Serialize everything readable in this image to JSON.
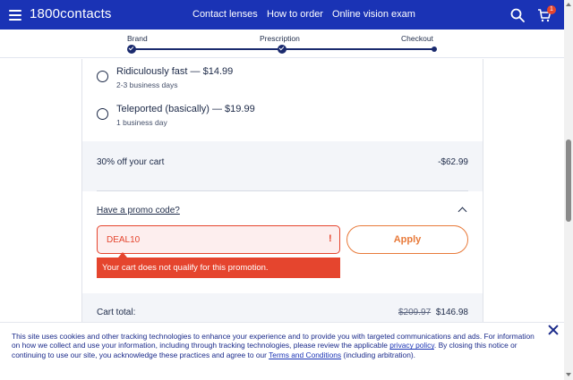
{
  "header": {
    "logo": "1800contacts",
    "nav": [
      "Contact lenses",
      "How to order",
      "Online vision exam"
    ],
    "cart_count": "1",
    "icons": [
      "menu-icon",
      "search-icon",
      "cart-icon"
    ]
  },
  "progress": {
    "steps": [
      "Brand",
      "Prescription",
      "Checkout"
    ]
  },
  "shipping": {
    "options": [
      {
        "title": "Ridiculously fast — $14.99",
        "sub": "2-3 business days"
      },
      {
        "title": "Teleported (basically) — $19.99",
        "sub": "1 business day"
      }
    ]
  },
  "summary": {
    "discount_label": "30% off your cart",
    "discount_value": "-$62.99",
    "promo_link": "Have a promo code?",
    "promo_value": "DEAL10",
    "alert_glyph": "!",
    "apply_label": "Apply",
    "error": "Your cart does not qualify for this promotion.",
    "total_label": "Cart total:",
    "old_total": "$209.97",
    "new_total": "$146.98"
  },
  "cookie": {
    "text_1": "This site uses cookies and other tracking technologies to enhance your experience and to provide you with targeted communications and ads. For information on how we collect and use your information, including through tracking technologies, please review the applicable ",
    "link_privacy": "privacy policy",
    "text_2": ". By closing this notice or continuing to use our site, you acknowledge these practices and agree to our ",
    "link_terms": "Terms and Conditions",
    "text_3": " (including arbitration)."
  },
  "colors": {
    "brand_blue": "#1a33b5",
    "error_red": "#e5452e",
    "apply_orange": "#e87a3a"
  }
}
